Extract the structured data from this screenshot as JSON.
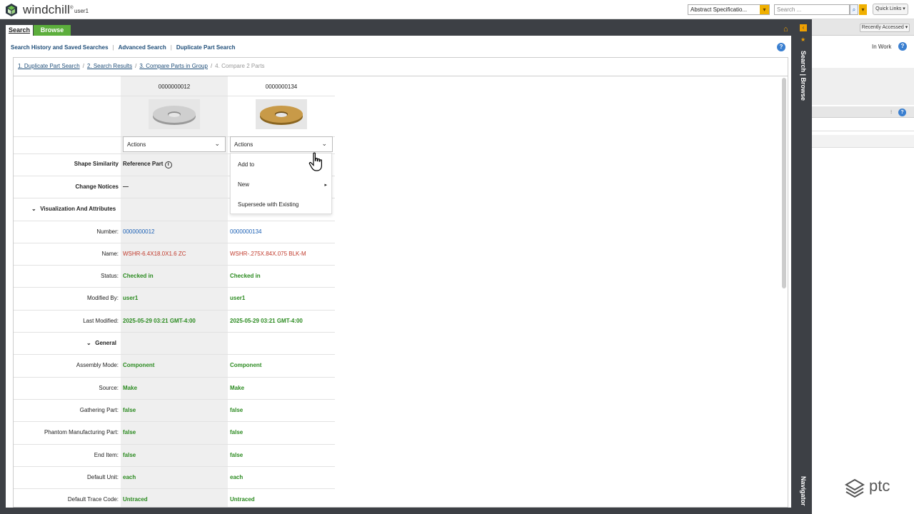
{
  "topbar": {
    "brand": "windchill",
    "trademark": "®",
    "username": "user1",
    "context_select": "Abstract Specificatio...",
    "search_placeholder": "Search ...",
    "quick_links": "Quick Links"
  },
  "tabs": {
    "search": "Search",
    "browse": "Browse"
  },
  "links": {
    "history": "Search History and Saved Searches",
    "advanced": "Advanced Search",
    "duplicate": "Duplicate Part Search"
  },
  "breadcrumbs": {
    "step1": "1. Duplicate Part Search",
    "step2": "2. Search Results",
    "step3": "3. Compare Parts in Group",
    "step4": "4. Compare 2 Parts",
    "sep": "/"
  },
  "compare": {
    "part1_header": "0000000012",
    "part2_header": "0000000134",
    "actions_label": "Actions",
    "shape_similarity": {
      "label": "Shape Similarity",
      "v1": "Reference Part"
    },
    "change_notices": {
      "label": "Change Notices",
      "v1": "—"
    },
    "section_vis": "Visualization And Attributes",
    "section_general": "General",
    "rows": {
      "number": {
        "label": "Number:",
        "v1": "0000000012",
        "v2": "0000000134"
      },
      "name": {
        "label": "Name:",
        "v1": "WSHR-6.4X18.0X1.6 ZC",
        "v2": "WSHR-.275X.84X.075 BLK-M"
      },
      "status": {
        "label": "Status:",
        "v1": "Checked in",
        "v2": "Checked in"
      },
      "modified_by": {
        "label": "Modified By:",
        "v1": "user1",
        "v2": "user1"
      },
      "last_modified": {
        "label": "Last Modified:",
        "v1": "2025-05-29 03:21 GMT-4:00",
        "v2": "2025-05-29 03:21 GMT-4:00"
      },
      "assembly_mode": {
        "label": "Assembly Mode:",
        "v1": "Component",
        "v2": "Component"
      },
      "source": {
        "label": "Source:",
        "v1": "Make",
        "v2": "Make"
      },
      "gathering_part": {
        "label": "Gathering Part:",
        "v1": "false",
        "v2": "false"
      },
      "phantom": {
        "label": "Phantom Manufacturing Part:",
        "v1": "false",
        "v2": "false"
      },
      "end_item": {
        "label": "End Item:",
        "v1": "false",
        "v2": "false"
      },
      "default_unit": {
        "label": "Default Unit:",
        "v1": "each",
        "v2": "each"
      },
      "trace_code": {
        "label": "Default Trace Code:",
        "v1": "Untraced",
        "v2": "Untraced"
      }
    }
  },
  "menu": {
    "add_to": "Add to",
    "new": "New",
    "supersede": "Supersede with Existing"
  },
  "sidenav": {
    "search_browse": "Search | Browse",
    "navigator": "Navigator"
  },
  "rightpanel": {
    "recently_accessed": "Recently Accessed",
    "in_work": "In Work"
  },
  "footer_logo": "ptc",
  "colors": {
    "accent_green": "#5cae3c",
    "link_blue": "#1a5fb4",
    "value_green": "#2a8a1f",
    "name_red": "#c0392b",
    "frame_dark": "#3d4045",
    "orange": "#f0a000"
  }
}
